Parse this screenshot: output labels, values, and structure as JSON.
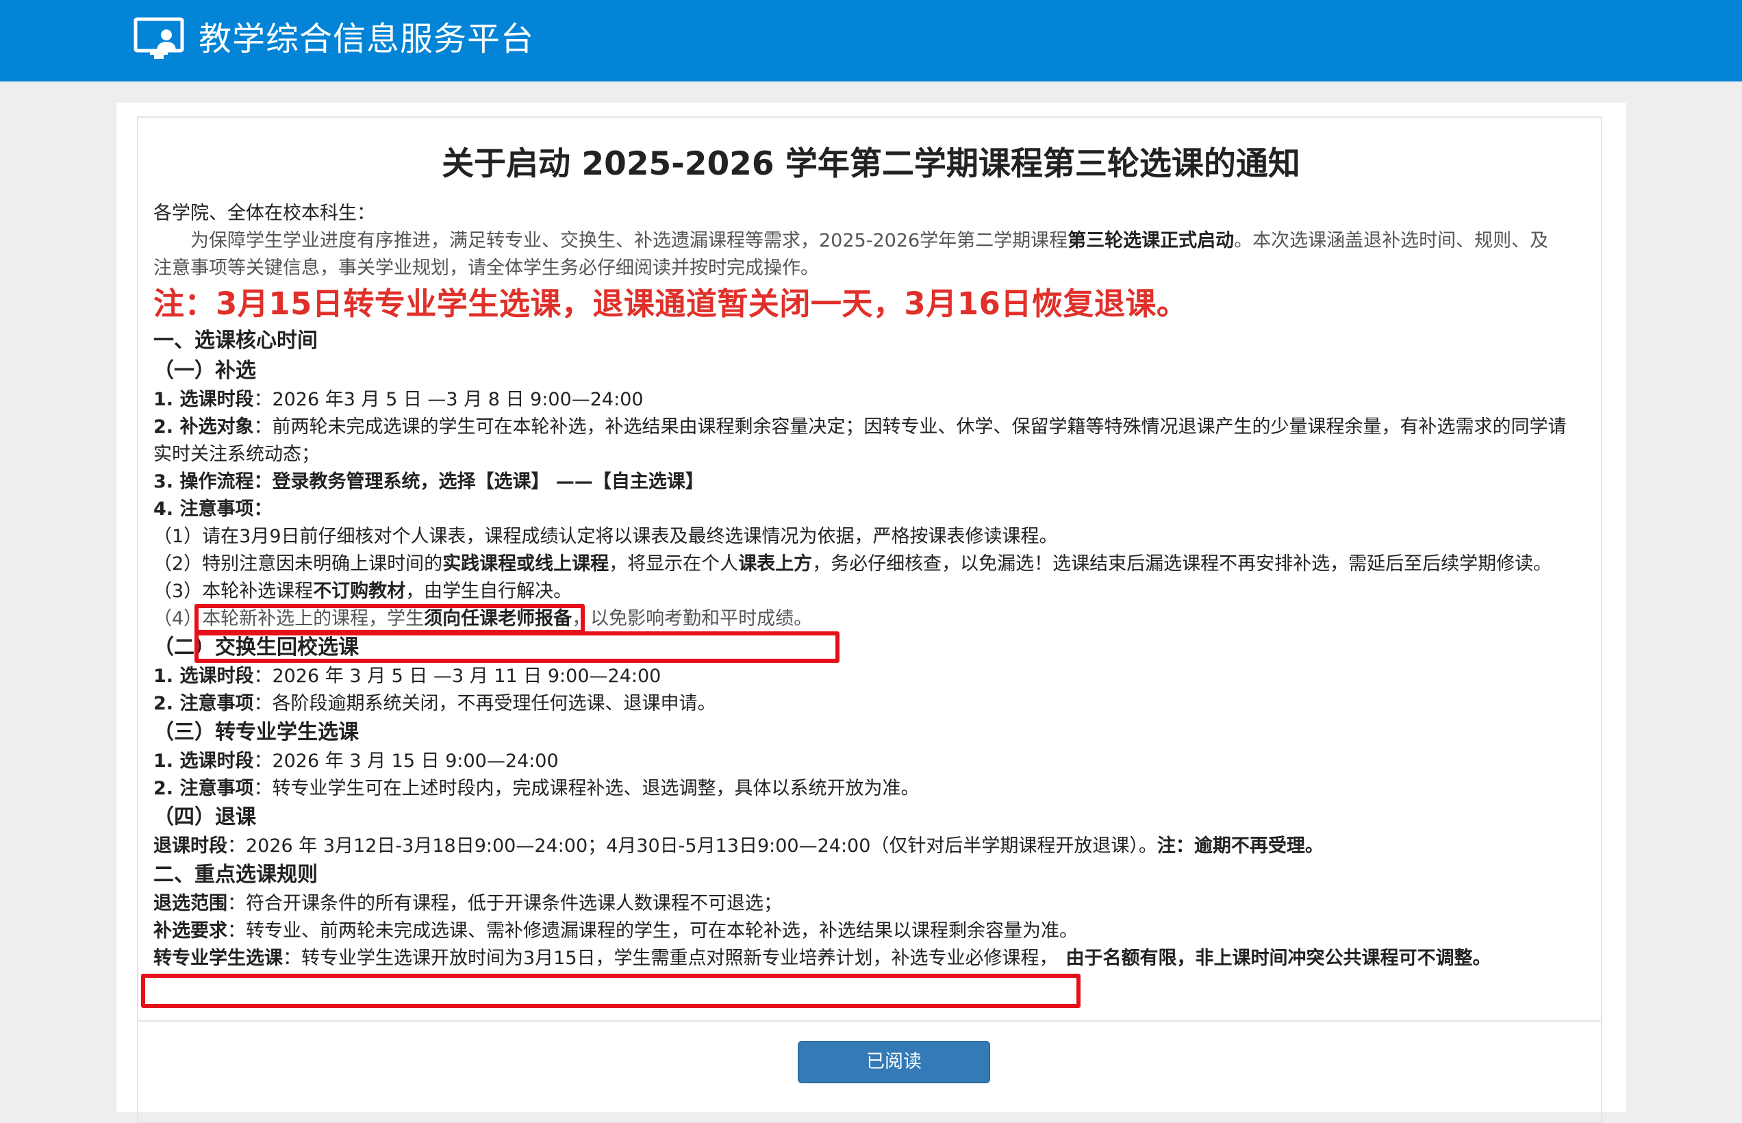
{
  "header": {
    "app_title": "教学综合信息服务平台",
    "logo_icon": "presentation-screen-icon",
    "bg_color": "#0384d6"
  },
  "notice": {
    "title": "关于启动 2025-2026 学年第二学期课程第三轮选课的通知",
    "greeting": "各学院、全体在校本科生：",
    "intro_1a": "为保障学生学业进度有序推进，满足转专业、交换生、补选遗漏课程等需求，2025-2026学年第二学期课程",
    "intro_1b": "第三轮选课正式启动",
    "intro_1c": "。本次选课涵盖退补选时间、规则、及",
    "intro_2": "注意事项等关键信息，事关学业规划，请全体学生务必仔细阅读并按时完成操作。",
    "alert": "注：3月15日转专业学生选课，退课通道暂关闭一天，3月16日恢复退课。",
    "sec1_title": "一、选课核心时间",
    "sub1_title": "（一）补选",
    "s1_time_label": "1. 选课时段",
    "s1_time_value": "：2026 年3 月 5 日 —3 月 8 日 9:00—24:00",
    "s1_obj_label": "2. 补选对象",
    "s1_obj_value": "：前两轮未完成选课的学生可在本轮补选，补选结果由课程剩余容量决定；因转专业、休学、保留学籍等特殊情况退课产生的少量课程余量，有补选需求的同学请实时关注系统动态；",
    "s1_flow": "3. 操作流程：登录教务管理系统，选择【选课】 ——【自主选课】",
    "s1_note_label": "4. 注意事项：",
    "s1_note1": "（1）请在3月9日前仔细核对个人课表，课程成绩认定将以课表及最终选课情况为依据，严格按课表修读课程。",
    "s1_note2a": "（2）特别注意因未明确上课时间的",
    "s1_note2b": "实践课程或线上课程",
    "s1_note2c": "，将显示在个人",
    "s1_note2d": "课表上方",
    "s1_note2e": "，务必仔细核查，以免漏选！选课结束后漏选课程不再安排补选，需延后至后续学期修读。",
    "s1_note3a": "（3）",
    "s1_note3b": "本轮补选课程",
    "s1_note3c": "不订购教材",
    "s1_note3d": "，由学生自行解决。",
    "s1_note4a": "（4）",
    "s1_note4b": "本轮新补选上的课程，学生",
    "s1_note4c": "须向任课老师报备",
    "s1_note4d": "，以免影响考勤和平时成绩。",
    "sub2_title": "（二）交换生回校选课",
    "s2_time_label": "1. 选课时段",
    "s2_time_value": "：2026 年 3 月 5 日 —3 月 11 日 9:00—24:00",
    "s2_note_label": "2. 注意事项",
    "s2_note_value": "：各阶段逾期系统关闭，不再受理任何选课、退课申请。",
    "sub3_title": "（三）转专业学生选课",
    "s3_time_label": "1. 选课时段",
    "s3_time_value": "：2026 年 3 月 15 日 9:00—24:00",
    "s3_note_label": "2. 注意事项",
    "s3_note_value": "：转专业学生可在上述时段内，完成课程补选、退选调整，具体以系统开放为准。",
    "sub4_title": "（四）退课",
    "s4_label": "退课时段",
    "s4_value": "：2026 年 3月12日-3月18日9:00—24:00；4月30日-5月13日9:00—24:00（仅针对后半学期课程开放退课）。",
    "s4_note": "注：逾期不再受理。",
    "sec2_title": "二、重点选课规则",
    "r1_label": "退选范围",
    "r1_value": "：符合开课条件的所有课程，低于开课条件选课人数课程不可退选；",
    "r2_label": "补选要求",
    "r2_value": "：转专业、前两轮未完成选课、需补修遗漏课程的学生，可在本轮补选，补选结果以课程剩余容量为准。",
    "r3_label": "转专业学生选课",
    "r3_value": "：转专业学生选课开放时间为3月15日，学生需重点对照新专业培养计划，补选专业必修课程，",
    "r3_tail": "由于名额有限，非上课时间冲突公共课程可不调整。"
  },
  "actions": {
    "read_button": "已阅读"
  },
  "colors": {
    "alert": "#e0302a",
    "highlight_box": "#e6101a",
    "button": "#337ab7"
  }
}
